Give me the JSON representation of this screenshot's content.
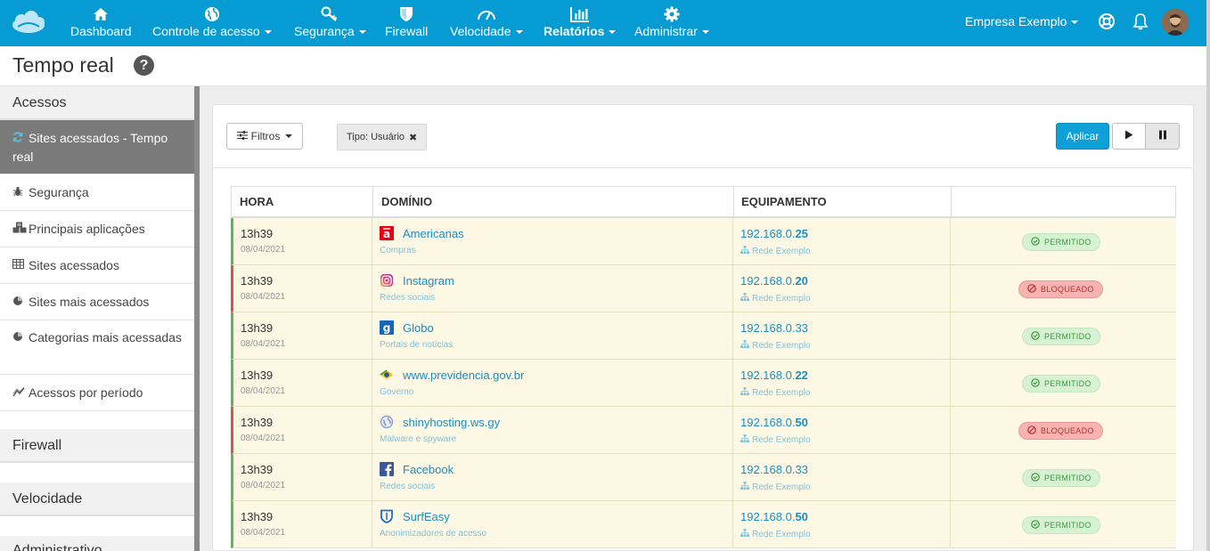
{
  "nav": {
    "items": [
      {
        "label": "Dashboard",
        "icon": "home-icon",
        "dropdown": false
      },
      {
        "label": "Controle de acesso",
        "icon": "globe-icon",
        "dropdown": true
      },
      {
        "label": "Segurança",
        "icon": "key-icon",
        "dropdown": true
      },
      {
        "label": "Firewall",
        "icon": "shield-icon",
        "dropdown": false
      },
      {
        "label": "Velocidade",
        "icon": "speedometer-icon",
        "dropdown": true
      },
      {
        "label": "Relatórios",
        "icon": "bar-chart-icon",
        "dropdown": true,
        "active": true
      },
      {
        "label": "Administrar",
        "icon": "gear-icon",
        "dropdown": true
      }
    ],
    "company": "Empresa Exemplo"
  },
  "page": {
    "title": "Tempo real"
  },
  "sidebar": {
    "sections": [
      {
        "title": "Acessos"
      },
      {
        "title": "Firewall"
      },
      {
        "title": "Velocidade"
      },
      {
        "title": "Administrativo"
      }
    ],
    "items": [
      {
        "label": "Sites acessados - Tempo real",
        "icon": "refresh-icon",
        "active": true
      },
      {
        "label": "Segurança",
        "icon": "bug-icon"
      },
      {
        "label": "Principais aplicações",
        "icon": "cubes-icon"
      },
      {
        "label": "Sites acessados",
        "icon": "table-icon"
      },
      {
        "label": "Sites mais acessados",
        "icon": "pie-chart-icon"
      },
      {
        "label": "Categorias mais acessadas",
        "icon": "pie-chart-icon"
      },
      {
        "label": "Acessos por período",
        "icon": "line-chart-icon"
      }
    ]
  },
  "toolbar": {
    "filters_label": "Filtros",
    "chip_label": "Tipo: Usuário",
    "apply_label": "Aplicar"
  },
  "table": {
    "headers": [
      "HORA",
      "DOMÍNIO",
      "EQUIPAMENTO",
      ""
    ],
    "rows": [
      {
        "time": "13h39",
        "date": "08/04/2021",
        "domain": "Americanas",
        "category": "Compras",
        "ip_prefix": "192.168.0.",
        "ip_suffix": "25",
        "ip_bold": true,
        "network": "Rede Exemplo",
        "status": "PERMITIDO",
        "allowed": true,
        "icon": "americanas-icon"
      },
      {
        "time": "13h39",
        "date": "08/04/2021",
        "domain": "Instagram",
        "category": "Redes sociais",
        "ip_prefix": "192.168.0.",
        "ip_suffix": "20",
        "ip_bold": true,
        "network": "Rede Exemplo",
        "status": "BLOQUEADO",
        "allowed": false,
        "icon": "instagram-icon"
      },
      {
        "time": "13h39",
        "date": "08/04/2021",
        "domain": "Globo",
        "category": "Portais de notícias",
        "ip_prefix": "192.168.0.",
        "ip_suffix": "33",
        "ip_bold": false,
        "network": "Rede Exemplo",
        "status": "PERMITIDO",
        "allowed": true,
        "icon": "globo-icon"
      },
      {
        "time": "13h39",
        "date": "08/04/2021",
        "domain": "www.previdencia.gov.br",
        "category": "Governo",
        "ip_prefix": "192.168.0.",
        "ip_suffix": "22",
        "ip_bold": true,
        "network": "Rede Exemplo",
        "status": "PERMITIDO",
        "allowed": true,
        "icon": "brazil-flag-icon"
      },
      {
        "time": "13h39",
        "date": "08/04/2021",
        "domain": "shinyhosting.ws.gy",
        "category": "Malware e spyware",
        "ip_prefix": "192.168.0.",
        "ip_suffix": "50",
        "ip_bold": true,
        "network": "Rede Exemplo",
        "status": "BLOQUEADO",
        "allowed": false,
        "icon": "world-icon"
      },
      {
        "time": "13h39",
        "date": "08/04/2021",
        "domain": "Facebook",
        "category": "Redes sociais",
        "ip_prefix": "192.168.0.",
        "ip_suffix": "33",
        "ip_bold": false,
        "network": "Rede Exemplo",
        "status": "PERMITIDO",
        "allowed": true,
        "icon": "facebook-icon"
      },
      {
        "time": "13h39",
        "date": "08/04/2021",
        "domain": "SurfEasy",
        "category": "Anonimizadores de acesso",
        "ip_prefix": "192.168.0.",
        "ip_suffix": "50",
        "ip_bold": true,
        "network": "Rede Exemplo",
        "status": "PERMITIDO",
        "allowed": true,
        "icon": "surfeasy-icon"
      }
    ]
  },
  "colors": {
    "navbar": "#079bd4",
    "allowed": "#5cb85c",
    "blocked": "#d9534f",
    "row_bg": "#fcf8e3"
  }
}
